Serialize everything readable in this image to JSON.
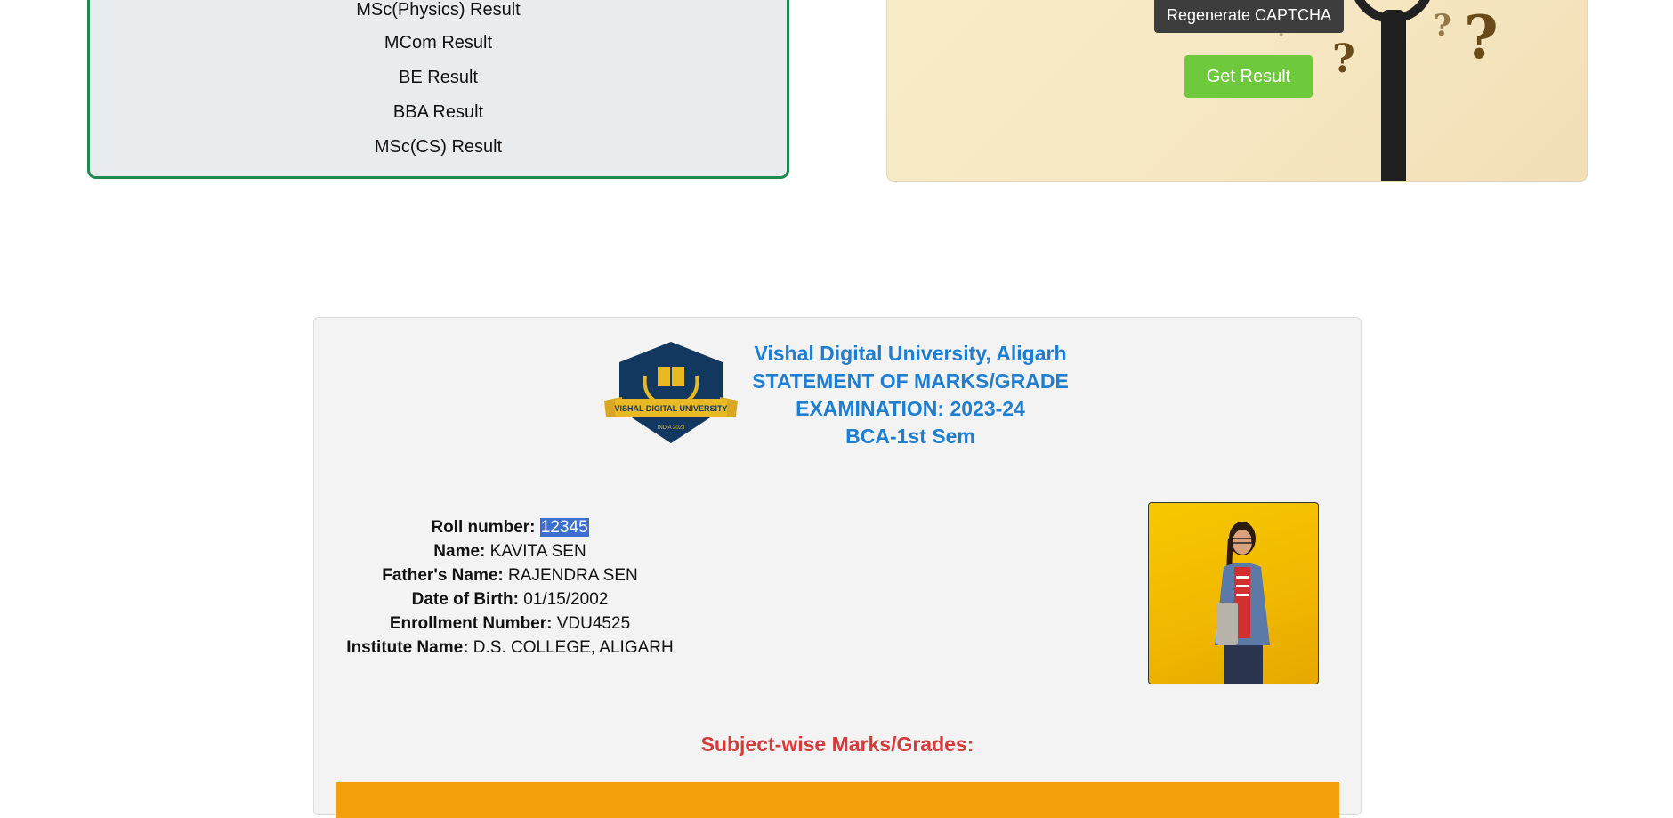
{
  "results_list": {
    "items": [
      "MSc(Physics) Result",
      "MCom Result",
      "BE Result",
      "BBA Result",
      "MSc(CS) Result"
    ]
  },
  "captcha": {
    "regenerate_label": "Regenerate CAPTCHA",
    "get_result_label": "Get Result"
  },
  "marksheet": {
    "logo_text": "VISHAL DIGITAL UNIVERSITY",
    "logo_subtext": "INDIA 2023",
    "header_lines": [
      "Vishal Digital University, Aligarh",
      "STATEMENT OF MARKS/GRADE",
      "EXAMINATION: 2023-24",
      "BCA-1st Sem"
    ],
    "fields": {
      "roll_label": "Roll number:",
      "roll_value": "12345",
      "name_label": "Name:",
      "name_value": "KAVITA SEN",
      "father_label": "Father's Name:",
      "father_value": "RAJENDRA SEN",
      "dob_label": "Date of Birth:",
      "dob_value": "01/15/2002",
      "enroll_label": "Enrollment Number:",
      "enroll_value": "VDU4525",
      "inst_label": "Institute Name:",
      "inst_value": "D.S. COLLEGE, ALIGARH"
    },
    "subject_heading": "Subject-wise Marks/Grades:"
  },
  "colors": {
    "heading_blue": "#1f7ed0",
    "subject_red": "#d63a3a",
    "button_green": "#6ec93d",
    "card_border_green": "#1e8a4f",
    "table_header_orange": "#f4a00c"
  }
}
